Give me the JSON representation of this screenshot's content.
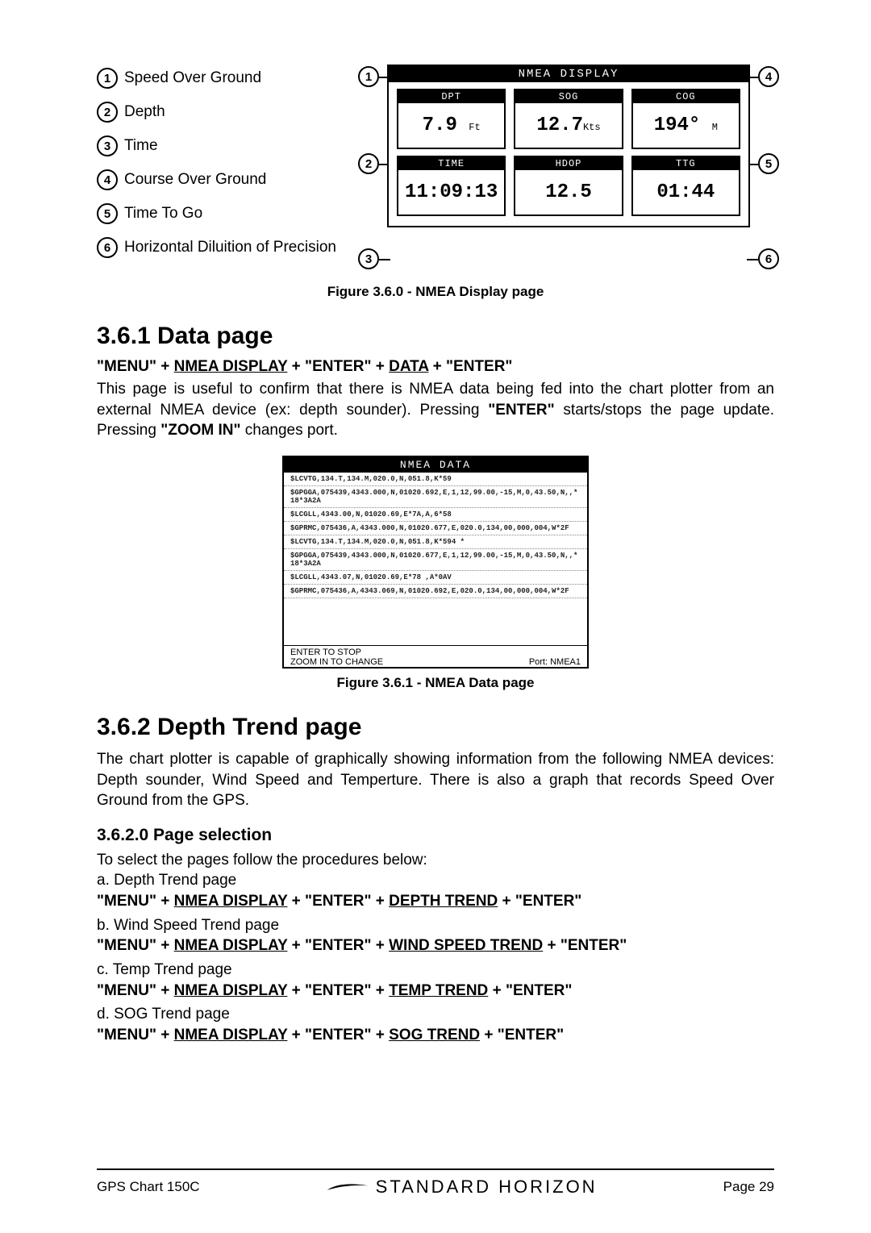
{
  "legend": {
    "items": [
      {
        "num": "1",
        "label": "Speed Over Ground"
      },
      {
        "num": "2",
        "label": "Depth"
      },
      {
        "num": "3",
        "label": "Time"
      },
      {
        "num": "4",
        "label": "Course Over Ground"
      },
      {
        "num": "5",
        "label": "Time To Go"
      },
      {
        "num": "6",
        "label": "Horizontal Diluition of Precision"
      }
    ]
  },
  "nmea_display": {
    "title": "NMEA DISPLAY",
    "cells": [
      {
        "header": "DPT",
        "value": "7.9",
        "unit": "Ft"
      },
      {
        "header": "SOG",
        "value": "12.7",
        "unit": "Kts"
      },
      {
        "header": "COG",
        "value": "194°",
        "unit": "M"
      },
      {
        "header": "TIME",
        "value": "11:09:13",
        "unit": ""
      },
      {
        "header": "HDOP",
        "value": "12.5",
        "unit": ""
      },
      {
        "header": "TTG",
        "value": "01:44",
        "unit": ""
      }
    ]
  },
  "fig_caption_0": "Figure 3.6.0 - NMEA Display page",
  "section_361": {
    "heading": "3.6.1 Data page",
    "nav": "\"MENU\" + NMEA DISPLAY + \"ENTER\" + DATA + \"ENTER\"",
    "para": "This page is useful to confirm that there is NMEA data being fed into the chart plotter from an external NMEA device (ex: depth sounder). Pressing \"ENTER\" starts/stops the page update. Pressing \"ZOOM IN\" changes port."
  },
  "nmea_data_screen": {
    "title": "NMEA DATA",
    "lines": [
      "$LCVTG,134.T,134.M,020.0,N,051.8,K*59",
      "$GPGGA,075439,4343.000,N,01020.692,E,1,12,99.00,-15,M,0,43.50,N,,*18*3A2A",
      "$LCGLL,4343.00,N,01020.69,E*7A,A,6*58",
      "$GPRMC,075436,A,4343.000,N,01020.677,E,020.0,134,00,000,004,W*2F",
      "$LCVTG,134.T,134.M,020.0,N,051.8,K*594 *",
      "$GPGGA,075439,4343.000,N,01020.677,E,1,12,99.00,-15,M,0,43.50,N,,*18*3A2A",
      "$LCGLL,4343.07,N,01020.69,E*78 ,A*0AV",
      "$GPRMC,075436,A,4343.069,N,01020.692,E,020.0,134,00,000,004,W*2F"
    ],
    "hint_enter": "ENTER TO STOP",
    "hint_zoom": "ZOOM IN TO CHANGE",
    "hint_port": "Port: NMEA1"
  },
  "fig_caption_1": "Figure 3.6.1 - NMEA Data page",
  "section_362": {
    "heading": "3.6.2 Depth Trend page",
    "para": "The chart plotter is capable of graphically showing information from the following NMEA devices: Depth sounder, Wind Speed and Temperture. There is also a graph that records Speed Over Ground from the GPS.",
    "sub_heading": "3.6.2.0 Page selection",
    "intro": "To select the pages follow the procedures below:",
    "procs": [
      {
        "label": "a. Depth Trend page",
        "nav_pre": "\"MENU\" + ",
        "nav_u1": "NMEA DISPLAY",
        "nav_mid": " + \"ENTER\" + ",
        "nav_u2": "DEPTH TREND",
        "nav_end": " + \"ENTER\""
      },
      {
        "label": "b. Wind Speed Trend page",
        "nav_pre": "\"MENU\" + ",
        "nav_u1": "NMEA DISPLAY",
        "nav_mid": " + \"ENTER\" + ",
        "nav_u2": "WIND SPEED TREND",
        "nav_end": " + \"ENTER\""
      },
      {
        "label": "c. Temp Trend page",
        "nav_pre": "\"MENU\" + ",
        "nav_u1": "NMEA DISPLAY",
        "nav_mid": " + \"ENTER\" + ",
        "nav_u2": "TEMP TREND",
        "nav_end": " + \"ENTER\""
      },
      {
        "label": "d. SOG Trend page",
        "nav_pre": "\"MENU\" + ",
        "nav_u1": "NMEA DISPLAY",
        "nav_mid": " + \"ENTER\" + ",
        "nav_u2": "SOG TREND",
        "nav_end": " + \"ENTER\""
      }
    ]
  },
  "footer": {
    "left": "GPS Chart 150C",
    "brand": "STANDARD HORIZON",
    "right": "Page 29"
  }
}
